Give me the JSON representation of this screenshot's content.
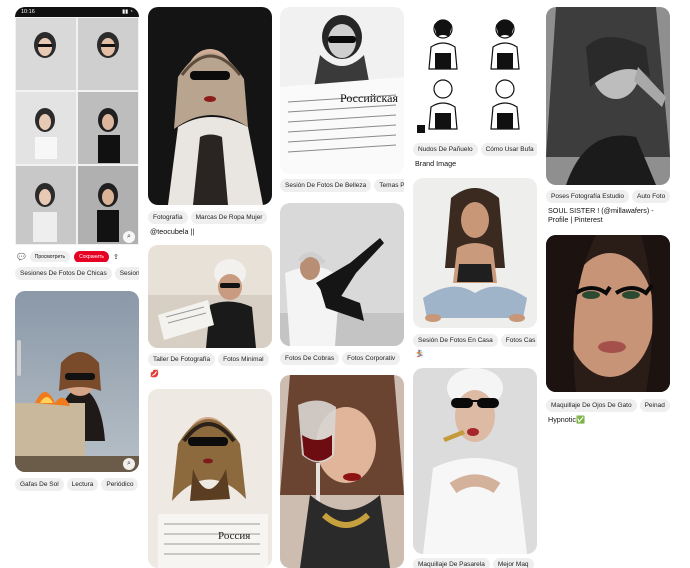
{
  "phone": {
    "time": "10:16",
    "signal": "▮▮ ◔",
    "view_label": "Просмотреть",
    "save_label": "Сохранить"
  },
  "pins": [
    {
      "id": "p1",
      "tags": [
        "Sesiones De Fotos De Chicas",
        "Sesion"
      ]
    },
    {
      "id": "p2",
      "tags": [
        "Gafas De Sol",
        "Lectura",
        "Periódico"
      ]
    },
    {
      "id": "p3",
      "tags": [
        "Fotografía",
        "Marcas De Ropa Mujer"
      ],
      "caption": "@teocubela ||"
    },
    {
      "id": "p4",
      "tags": [
        "Taller De Fotografía",
        "Fotos Minimal"
      ],
      "caption_icon": "💋"
    },
    {
      "id": "p6",
      "tags": [
        "Sesión De Fotos De Belleza",
        "Temas P"
      ]
    },
    {
      "id": "p7",
      "tags": [
        "Fotos De Cobras",
        "Fotos Corporativ"
      ]
    },
    {
      "id": "p9",
      "tags": [
        "Nudos De Pañuelo",
        "Cómo Usar Bufa"
      ],
      "caption": "Brand Image"
    },
    {
      "id": "p10",
      "tags": [
        "Sesión De Fotos En Casa",
        "Fotos Cas"
      ],
      "caption": "🏂"
    },
    {
      "id": "p11",
      "tags": [
        "Maquillaje De Pasarela",
        "Mejor Maq"
      ]
    },
    {
      "id": "p12",
      "tags": [
        "Poses Fotografía Estudio",
        "Auto Foto"
      ],
      "caption": "SOUL SISTER ! (@millawafers) - Profile | Pinterest"
    },
    {
      "id": "p13",
      "tags": [
        "Maquillaje De Ojos De Gato",
        "Peinad"
      ],
      "caption": "Hypnotic✅"
    }
  ],
  "colors": {
    "accent": "#e60023",
    "tag_bg": "#efefef"
  },
  "icons": [
    "comment-icon",
    "share-icon",
    "lens-icon",
    "more-icon"
  ]
}
